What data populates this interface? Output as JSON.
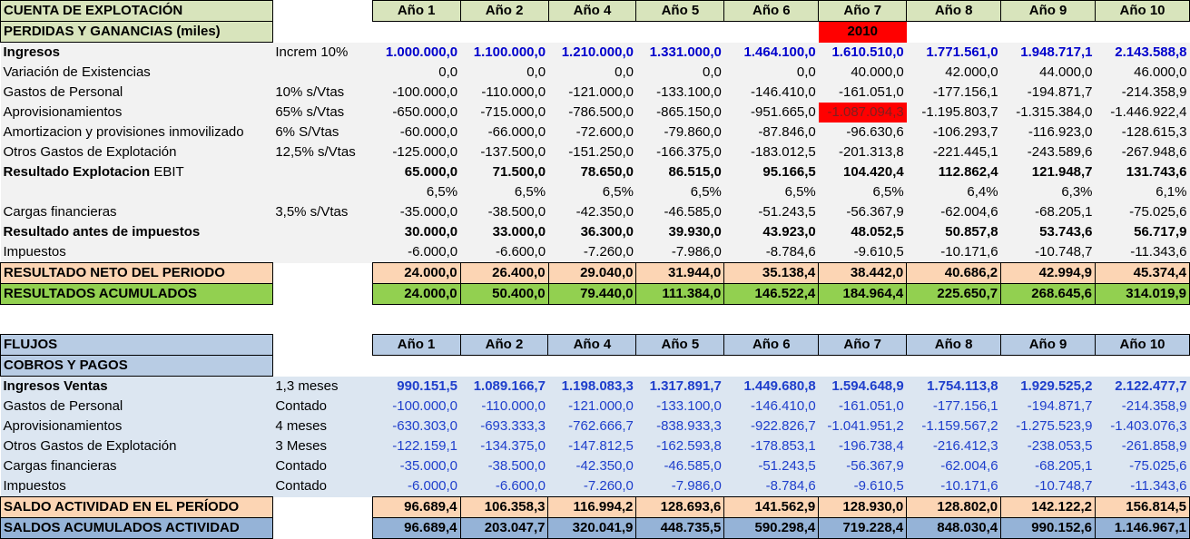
{
  "top": {
    "title": "CUENTA DE EXPLOTACIÓN",
    "subtitle": "PERDIDAS Y GANANCIAS  (miles)",
    "years": [
      "Año 1",
      "Año 2",
      "Año 4",
      "Año 5",
      "Año 6",
      "Año 7",
      "Año 8",
      "Año 9",
      "Año 10"
    ],
    "year_marker": "2010",
    "rows": [
      {
        "label": "Ingresos",
        "note": "Increm 10%",
        "bold": true,
        "blue": true,
        "values": [
          "1.000.000,0",
          "1.100.000,0",
          "1.210.000,0",
          "1.331.000,0",
          "1.464.100,0",
          "1.610.510,0",
          "1.771.561,0",
          "1.948.717,1",
          "2.143.588,8"
        ]
      },
      {
        "label": "Variación de Existencias",
        "note": "",
        "values": [
          "0,0",
          "0,0",
          "0,0",
          "0,0",
          "0,0",
          "40.000,0",
          "42.000,0",
          "44.000,0",
          "46.000,0"
        ]
      },
      {
        "label": "Gastos de Personal",
        "note": "10% s/Vtas",
        "values": [
          "-100.000,0",
          "-110.000,0",
          "-121.000,0",
          "-133.100,0",
          "-146.410,0",
          "-161.051,0",
          "-177.156,1",
          "-194.871,7",
          "-214.358,9"
        ]
      },
      {
        "label": "Aprovisionamientos",
        "note": "65% s/Vtas",
        "values": [
          "-650.000,0",
          "-715.000,0",
          "-786.500,0",
          "-865.150,0",
          "-951.665,0",
          "-1.087.094,3",
          "-1.195.803,7",
          "-1.315.384,0",
          "-1.446.922,4"
        ]
      },
      {
        "label": "Amortizacion y provisiones inmovilizado",
        "note": "6% S/Vtas",
        "values": [
          "-60.000,0",
          "-66.000,0",
          "-72.600,0",
          "-79.860,0",
          "-87.846,0",
          "-96.630,6",
          "-106.293,7",
          "-116.923,0",
          "-128.615,3"
        ]
      },
      {
        "label": "Otros Gastos de Explotación",
        "note": "12,5% s/Vtas",
        "values": [
          "-125.000,0",
          "-137.500,0",
          "-151.250,0",
          "-166.375,0",
          "-183.012,5",
          "-201.313,8",
          "-221.445,1",
          "-243.589,6",
          "-267.948,6"
        ]
      },
      {
        "label": "Resultado Explotacion",
        "label_suffix": " EBIT",
        "note": "",
        "bold": true,
        "values": [
          "65.000,0",
          "71.500,0",
          "78.650,0",
          "86.515,0",
          "95.166,5",
          "104.420,4",
          "112.862,4",
          "121.948,7",
          "131.743,6"
        ]
      },
      {
        "label": "",
        "note": "",
        "values": [
          "6,5%",
          "6,5%",
          "6,5%",
          "6,5%",
          "6,5%",
          "6,5%",
          "6,4%",
          "6,3%",
          "6,1%"
        ]
      },
      {
        "label": "Cargas financieras",
        "note": "3,5% s/Vtas",
        "values": [
          "-35.000,0",
          "-38.500,0",
          "-42.350,0",
          "-46.585,0",
          "-51.243,5",
          "-56.367,9",
          "-62.004,6",
          "-68.205,1",
          "-75.025,6"
        ]
      },
      {
        "label": "Resultado antes de impuestos",
        "note": "",
        "bold": true,
        "values": [
          "30.000,0",
          "33.000,0",
          "36.300,0",
          "39.930,0",
          "43.923,0",
          "48.052,5",
          "50.857,8",
          "53.743,6",
          "56.717,9"
        ]
      },
      {
        "label": "Impuestos",
        "note": "",
        "values": [
          "-6.000,0",
          "-6.600,0",
          "-7.260,0",
          "-7.986,0",
          "-8.784,6",
          "-9.610,5",
          "-10.171,6",
          "-10.748,7",
          "-11.343,6"
        ]
      }
    ],
    "neto": {
      "label": "RESULTADO NETO DEL PERIODO",
      "values": [
        "24.000,0",
        "26.400,0",
        "29.040,0",
        "31.944,0",
        "35.138,4",
        "38.442,0",
        "40.686,2",
        "42.994,9",
        "45.374,4"
      ]
    },
    "acumulados": {
      "label": "RESULTADOS ACUMULADOS",
      "values": [
        "24.000,0",
        "50.400,0",
        "79.440,0",
        "111.384,0",
        "146.522,4",
        "184.964,4",
        "225.650,7",
        "268.645,6",
        "314.019,9"
      ]
    }
  },
  "bottom": {
    "title": "FLUJOS",
    "subtitle": "COBROS Y PAGOS",
    "years": [
      "Año 1",
      "Año 2",
      "Año 4",
      "Año 5",
      "Año 6",
      "Año 7",
      "Año 8",
      "Año 9",
      "Año 10"
    ],
    "rows": [
      {
        "label": "Ingresos Ventas",
        "note": "1,3 meses",
        "bold": true,
        "values": [
          "990.151,5",
          "1.089.166,7",
          "1.198.083,3",
          "1.317.891,7",
          "1.449.680,8",
          "1.594.648,9",
          "1.754.113,8",
          "1.929.525,2",
          "2.122.477,7"
        ]
      },
      {
        "label": "Gastos de Personal",
        "note": "Contado",
        "values": [
          "-100.000,0",
          "-110.000,0",
          "-121.000,0",
          "-133.100,0",
          "-146.410,0",
          "-161.051,0",
          "-177.156,1",
          "-194.871,7",
          "-214.358,9"
        ]
      },
      {
        "label": "Aprovisionamientos",
        "note": "4 meses",
        "values": [
          "-630.303,0",
          "-693.333,3",
          "-762.666,7",
          "-838.933,3",
          "-922.826,7",
          "-1.041.951,2",
          "-1.159.567,2",
          "-1.275.523,9",
          "-1.403.076,3"
        ]
      },
      {
        "label": "Otros Gastos de Explotación",
        "note": "3 Meses",
        "values": [
          "-122.159,1",
          "-134.375,0",
          "-147.812,5",
          "-162.593,8",
          "-178.853,1",
          "-196.738,4",
          "-216.412,3",
          "-238.053,5",
          "-261.858,9"
        ]
      },
      {
        "label": "Cargas financieras",
        "note": "Contado",
        "values": [
          "-35.000,0",
          "-38.500,0",
          "-42.350,0",
          "-46.585,0",
          "-51.243,5",
          "-56.367,9",
          "-62.004,6",
          "-68.205,1",
          "-75.025,6"
        ]
      },
      {
        "label": "Impuestos",
        "note": "Contado",
        "values": [
          "-6.000,0",
          "-6.600,0",
          "-7.260,0",
          "-7.986,0",
          "-8.784,6",
          "-9.610,5",
          "-10.171,6",
          "-10.748,7",
          "-11.343,6"
        ]
      }
    ],
    "saldo": {
      "label": "SALDO ACTIVIDAD EN EL PERÍODO",
      "values": [
        "96.689,4",
        "106.358,3",
        "116.994,2",
        "128.693,6",
        "141.562,9",
        "128.930,0",
        "128.802,0",
        "142.122,2",
        "156.814,5"
      ]
    },
    "saldos_acum": {
      "label": "SALDOS ACUMULADOS ACTIVIDAD",
      "values": [
        "96.689,4",
        "203.047,7",
        "320.041,9",
        "448.735,5",
        "590.298,4",
        "719.228,4",
        "848.030,4",
        "990.152,6",
        "1.146.967,1"
      ]
    }
  },
  "colors": {
    "header_green": "#d8e4bc",
    "header_blue": "#b8cce4",
    "orange": "#fcd5b4",
    "green": "#92d050",
    "steel": "#95b3d7",
    "alert_red": "#ff0000"
  }
}
